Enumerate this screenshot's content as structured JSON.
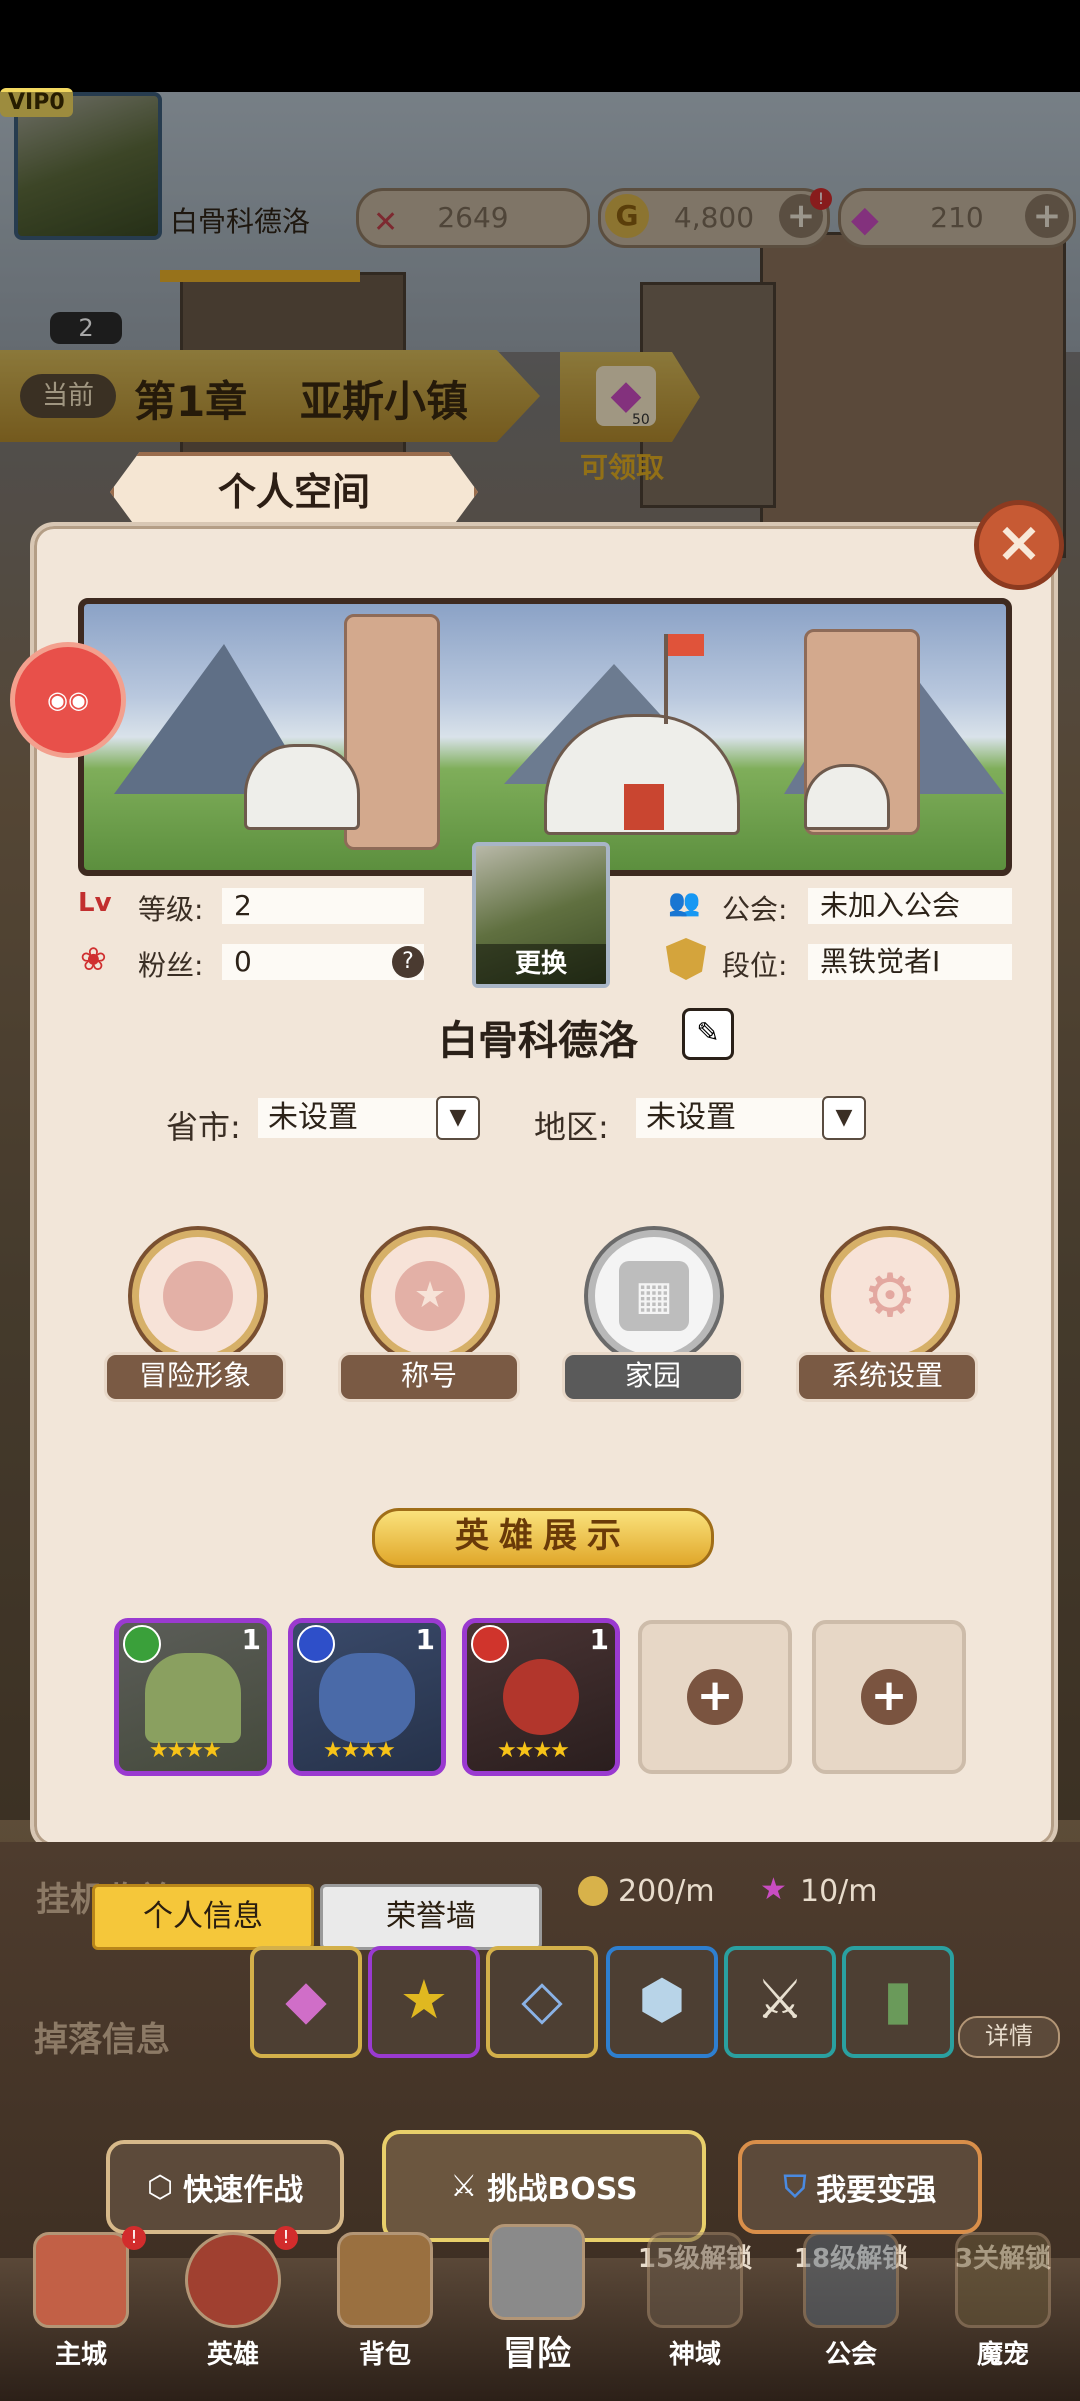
{
  "topbar": {
    "vip_label": "VIP",
    "vip_level": "0",
    "player_level": "2",
    "player_name": "白骨科德洛",
    "power": "2649",
    "gold": "4,800",
    "gems": "210"
  },
  "chapter": {
    "current_label": "当前",
    "chapter_label": "第1章",
    "location": "亚斯小镇",
    "reward_count": "50",
    "reward_status": "可领取"
  },
  "panel": {
    "title": "个人空间",
    "level_label": "等级:",
    "level_value": "2",
    "fans_label": "粉丝:",
    "fans_value": "0",
    "guild_label": "公会:",
    "guild_value": "未加入公会",
    "rank_label": "段位:",
    "rank_value": "黑铁觉者Ⅰ",
    "change_label": "更换",
    "player_name": "白骨科德洛",
    "province_label": "省市:",
    "province_value": "未设置",
    "region_label": "地区:",
    "region_value": "未设置",
    "lv_badge": "Lv",
    "help_glyph": "?",
    "actions": [
      {
        "label": "冒险形象"
      },
      {
        "label": "称号"
      },
      {
        "label": "家园"
      },
      {
        "label": "系统设置"
      }
    ],
    "hero_display_label": "英雄展示",
    "heroes": [
      {
        "count": "1",
        "stars": "★★★★",
        "element_color": "#3aa03a"
      },
      {
        "count": "1",
        "stars": "★★★★",
        "element_color": "#2e4fc9"
      },
      {
        "count": "1",
        "stars": "★★★★",
        "element_color": "#d0342c"
      }
    ]
  },
  "tabs": [
    {
      "label": "个人信息"
    },
    {
      "label": "荣誉墙"
    }
  ],
  "idle": {
    "title_partial": "挂机收益",
    "gold_rate": "200/m",
    "star_rate": "10/m"
  },
  "loot": {
    "title": "掉落信息",
    "detail_label": "详情"
  },
  "actions": {
    "quick_battle": "快速作战",
    "challenge_boss": "挑战BOSS",
    "get_stronger": "我要变强"
  },
  "bottom_nav": [
    {
      "label": "主城",
      "sub": ""
    },
    {
      "label": "英雄",
      "sub": ""
    },
    {
      "label": "背包",
      "sub": ""
    },
    {
      "label": "冒险",
      "sub": ""
    },
    {
      "label": "神域",
      "sub": "15级解锁"
    },
    {
      "label": "公会",
      "sub": "18级解锁"
    },
    {
      "label": "魔宠",
      "sub": "3关解锁"
    }
  ],
  "colors": {
    "panel_bg": "#f2e6d9",
    "accent_gold": "#e0a72a",
    "close_red": "#c75a34",
    "hero_border_purple": "#9a3ad0"
  }
}
